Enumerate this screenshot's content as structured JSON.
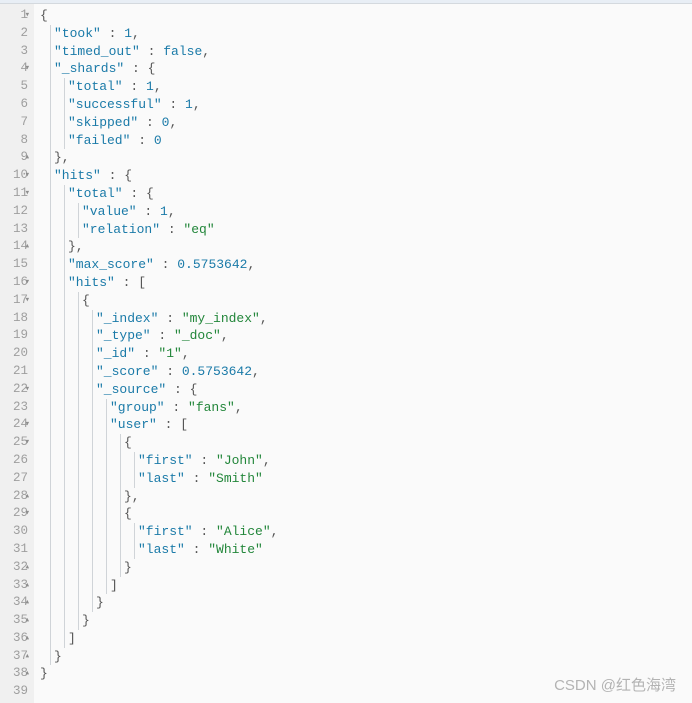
{
  "watermark": "CSDN @红色海湾",
  "gutter": [
    {
      "n": "1",
      "f": "▾"
    },
    {
      "n": "2"
    },
    {
      "n": "3"
    },
    {
      "n": "4",
      "f": "▾"
    },
    {
      "n": "5"
    },
    {
      "n": "6"
    },
    {
      "n": "7"
    },
    {
      "n": "8"
    },
    {
      "n": "9",
      "f": "▴"
    },
    {
      "n": "10",
      "f": "▾"
    },
    {
      "n": "11",
      "f": "▾"
    },
    {
      "n": "12"
    },
    {
      "n": "13"
    },
    {
      "n": "14",
      "f": "▴"
    },
    {
      "n": "15"
    },
    {
      "n": "16",
      "f": "▾"
    },
    {
      "n": "17",
      "f": "▾"
    },
    {
      "n": "18"
    },
    {
      "n": "19"
    },
    {
      "n": "20"
    },
    {
      "n": "21"
    },
    {
      "n": "22",
      "f": "▾"
    },
    {
      "n": "23"
    },
    {
      "n": "24",
      "f": "▾"
    },
    {
      "n": "25",
      "f": "▾"
    },
    {
      "n": "26"
    },
    {
      "n": "27"
    },
    {
      "n": "28",
      "f": "▴"
    },
    {
      "n": "29",
      "f": "▾"
    },
    {
      "n": "30"
    },
    {
      "n": "31"
    },
    {
      "n": "32",
      "f": "▴"
    },
    {
      "n": "33",
      "f": "▴"
    },
    {
      "n": "34",
      "f": "▴"
    },
    {
      "n": "35",
      "f": "▴"
    },
    {
      "n": "36",
      "f": "▴"
    },
    {
      "n": "37",
      "f": "▴"
    },
    {
      "n": "38",
      "f": "▴"
    },
    {
      "n": "39"
    }
  ],
  "lines": [
    {
      "indent": 0,
      "guides": [],
      "tokens": [
        [
          "p",
          "{"
        ]
      ]
    },
    {
      "indent": 1,
      "guides": [
        0
      ],
      "tokens": [
        [
          "k",
          "\"took\""
        ],
        [
          "p",
          " : "
        ],
        [
          "n",
          "1"
        ],
        [
          "p",
          ","
        ]
      ]
    },
    {
      "indent": 1,
      "guides": [
        0
      ],
      "tokens": [
        [
          "k",
          "\"timed_out\""
        ],
        [
          "p",
          " : "
        ],
        [
          "b",
          "false"
        ],
        [
          "p",
          ","
        ]
      ]
    },
    {
      "indent": 1,
      "guides": [
        0
      ],
      "tokens": [
        [
          "k",
          "\"_shards\""
        ],
        [
          "p",
          " : {"
        ]
      ]
    },
    {
      "indent": 2,
      "guides": [
        0,
        1
      ],
      "tokens": [
        [
          "k",
          "\"total\""
        ],
        [
          "p",
          " : "
        ],
        [
          "n",
          "1"
        ],
        [
          "p",
          ","
        ]
      ]
    },
    {
      "indent": 2,
      "guides": [
        0,
        1
      ],
      "tokens": [
        [
          "k",
          "\"successful\""
        ],
        [
          "p",
          " : "
        ],
        [
          "n",
          "1"
        ],
        [
          "p",
          ","
        ]
      ]
    },
    {
      "indent": 2,
      "guides": [
        0,
        1
      ],
      "tokens": [
        [
          "k",
          "\"skipped\""
        ],
        [
          "p",
          " : "
        ],
        [
          "n",
          "0"
        ],
        [
          "p",
          ","
        ]
      ]
    },
    {
      "indent": 2,
      "guides": [
        0,
        1
      ],
      "tokens": [
        [
          "k",
          "\"failed\""
        ],
        [
          "p",
          " : "
        ],
        [
          "n",
          "0"
        ]
      ]
    },
    {
      "indent": 1,
      "guides": [
        0
      ],
      "tokens": [
        [
          "p",
          "},"
        ]
      ]
    },
    {
      "indent": 1,
      "guides": [
        0
      ],
      "tokens": [
        [
          "k",
          "\"hits\""
        ],
        [
          "p",
          " : {"
        ]
      ]
    },
    {
      "indent": 2,
      "guides": [
        0,
        1
      ],
      "tokens": [
        [
          "k",
          "\"total\""
        ],
        [
          "p",
          " : {"
        ]
      ]
    },
    {
      "indent": 3,
      "guides": [
        0,
        1,
        2
      ],
      "tokens": [
        [
          "k",
          "\"value\""
        ],
        [
          "p",
          " : "
        ],
        [
          "n",
          "1"
        ],
        [
          "p",
          ","
        ]
      ]
    },
    {
      "indent": 3,
      "guides": [
        0,
        1,
        2
      ],
      "tokens": [
        [
          "k",
          "\"relation\""
        ],
        [
          "p",
          " : "
        ],
        [
          "s",
          "\"eq\""
        ]
      ]
    },
    {
      "indent": 2,
      "guides": [
        0,
        1
      ],
      "tokens": [
        [
          "p",
          "},"
        ]
      ]
    },
    {
      "indent": 2,
      "guides": [
        0,
        1
      ],
      "tokens": [
        [
          "k",
          "\"max_score\""
        ],
        [
          "p",
          " : "
        ],
        [
          "n",
          "0.5753642"
        ],
        [
          "p",
          ","
        ]
      ]
    },
    {
      "indent": 2,
      "guides": [
        0,
        1
      ],
      "tokens": [
        [
          "k",
          "\"hits\""
        ],
        [
          "p",
          " : ["
        ]
      ]
    },
    {
      "indent": 3,
      "guides": [
        0,
        1,
        2
      ],
      "tokens": [
        [
          "p",
          "{"
        ]
      ]
    },
    {
      "indent": 4,
      "guides": [
        0,
        1,
        2,
        3
      ],
      "tokens": [
        [
          "k",
          "\"_index\""
        ],
        [
          "p",
          " : "
        ],
        [
          "s",
          "\"my_index\""
        ],
        [
          "p",
          ","
        ]
      ]
    },
    {
      "indent": 4,
      "guides": [
        0,
        1,
        2,
        3
      ],
      "tokens": [
        [
          "k",
          "\"_type\""
        ],
        [
          "p",
          " : "
        ],
        [
          "s",
          "\"_doc\""
        ],
        [
          "p",
          ","
        ]
      ]
    },
    {
      "indent": 4,
      "guides": [
        0,
        1,
        2,
        3
      ],
      "tokens": [
        [
          "k",
          "\"_id\""
        ],
        [
          "p",
          " : "
        ],
        [
          "s",
          "\"1\""
        ],
        [
          "p",
          ","
        ]
      ]
    },
    {
      "indent": 4,
      "guides": [
        0,
        1,
        2,
        3
      ],
      "tokens": [
        [
          "k",
          "\"_score\""
        ],
        [
          "p",
          " : "
        ],
        [
          "n",
          "0.5753642"
        ],
        [
          "p",
          ","
        ]
      ]
    },
    {
      "indent": 4,
      "guides": [
        0,
        1,
        2,
        3
      ],
      "tokens": [
        [
          "k",
          "\"_source\""
        ],
        [
          "p",
          " : {"
        ]
      ]
    },
    {
      "indent": 5,
      "guides": [
        0,
        1,
        2,
        3,
        4
      ],
      "tokens": [
        [
          "k",
          "\"group\""
        ],
        [
          "p",
          " : "
        ],
        [
          "s",
          "\"fans\""
        ],
        [
          "p",
          ","
        ]
      ]
    },
    {
      "indent": 5,
      "guides": [
        0,
        1,
        2,
        3,
        4
      ],
      "tokens": [
        [
          "k",
          "\"user\""
        ],
        [
          "p",
          " : ["
        ]
      ]
    },
    {
      "indent": 6,
      "guides": [
        0,
        1,
        2,
        3,
        4,
        5
      ],
      "tokens": [
        [
          "p",
          "{"
        ]
      ]
    },
    {
      "indent": 7,
      "guides": [
        0,
        1,
        2,
        3,
        4,
        5,
        6
      ],
      "tokens": [
        [
          "k",
          "\"first\""
        ],
        [
          "p",
          " : "
        ],
        [
          "s",
          "\"John\""
        ],
        [
          "p",
          ","
        ]
      ]
    },
    {
      "indent": 7,
      "guides": [
        0,
        1,
        2,
        3,
        4,
        5,
        6
      ],
      "tokens": [
        [
          "k",
          "\"last\""
        ],
        [
          "p",
          " : "
        ],
        [
          "s",
          "\"Smith\""
        ]
      ]
    },
    {
      "indent": 6,
      "guides": [
        0,
        1,
        2,
        3,
        4,
        5
      ],
      "tokens": [
        [
          "p",
          "},"
        ]
      ]
    },
    {
      "indent": 6,
      "guides": [
        0,
        1,
        2,
        3,
        4,
        5
      ],
      "tokens": [
        [
          "p",
          "{"
        ]
      ]
    },
    {
      "indent": 7,
      "guides": [
        0,
        1,
        2,
        3,
        4,
        5,
        6
      ],
      "tokens": [
        [
          "k",
          "\"first\""
        ],
        [
          "p",
          " : "
        ],
        [
          "s",
          "\"Alice\""
        ],
        [
          "p",
          ","
        ]
      ]
    },
    {
      "indent": 7,
      "guides": [
        0,
        1,
        2,
        3,
        4,
        5,
        6
      ],
      "tokens": [
        [
          "k",
          "\"last\""
        ],
        [
          "p",
          " : "
        ],
        [
          "s",
          "\"White\""
        ]
      ]
    },
    {
      "indent": 6,
      "guides": [
        0,
        1,
        2,
        3,
        4,
        5
      ],
      "tokens": [
        [
          "p",
          "}"
        ]
      ]
    },
    {
      "indent": 5,
      "guides": [
        0,
        1,
        2,
        3,
        4
      ],
      "tokens": [
        [
          "p",
          "]"
        ]
      ]
    },
    {
      "indent": 4,
      "guides": [
        0,
        1,
        2,
        3
      ],
      "tokens": [
        [
          "p",
          "}"
        ]
      ]
    },
    {
      "indent": 3,
      "guides": [
        0,
        1,
        2
      ],
      "tokens": [
        [
          "p",
          "}"
        ]
      ]
    },
    {
      "indent": 2,
      "guides": [
        0,
        1
      ],
      "tokens": [
        [
          "p",
          "]"
        ]
      ]
    },
    {
      "indent": 1,
      "guides": [
        0
      ],
      "tokens": [
        [
          "p",
          "}"
        ]
      ]
    },
    {
      "indent": 0,
      "guides": [],
      "tokens": [
        [
          "p",
          "}"
        ]
      ]
    },
    {
      "indent": 0,
      "guides": [],
      "tokens": []
    }
  ]
}
